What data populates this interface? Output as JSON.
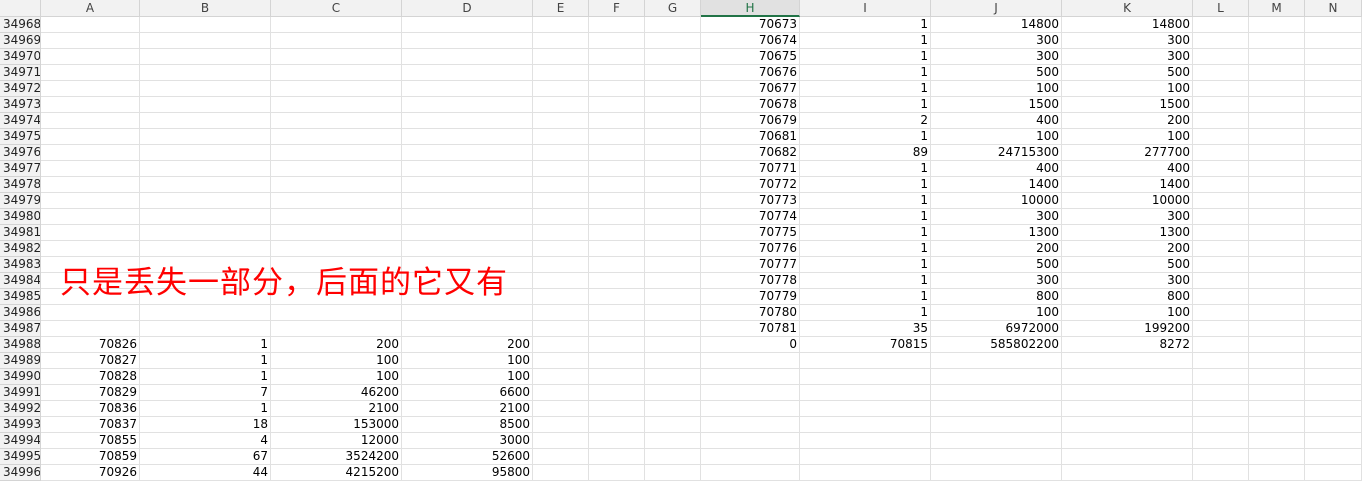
{
  "columns": [
    "A",
    "B",
    "C",
    "D",
    "E",
    "F",
    "G",
    "H",
    "I",
    "J",
    "K",
    "L",
    "M",
    "N"
  ],
  "selected_column": "H",
  "row_numbers": [
    34968,
    34969,
    34970,
    34971,
    34972,
    34973,
    34974,
    34975,
    34976,
    34977,
    34978,
    34979,
    34980,
    34981,
    34982,
    34983,
    34984,
    34985,
    34986,
    34987,
    34988,
    34989,
    34990,
    34991,
    34992,
    34993,
    34994,
    34995,
    34996
  ],
  "left_block": {
    "start_row_index": 20,
    "rows": [
      [
        "70826",
        "1",
        "200",
        "200"
      ],
      [
        "70827",
        "1",
        "100",
        "100"
      ],
      [
        "70828",
        "1",
        "100",
        "100"
      ],
      [
        "70829",
        "7",
        "46200",
        "6600"
      ],
      [
        "70836",
        "1",
        "2100",
        "2100"
      ],
      [
        "70837",
        "18",
        "153000",
        "8500"
      ],
      [
        "70855",
        "4",
        "12000",
        "3000"
      ],
      [
        "70859",
        "67",
        "3524200",
        "52600"
      ],
      [
        "70926",
        "44",
        "4215200",
        "95800"
      ]
    ]
  },
  "right_block": {
    "start_row_index": 0,
    "rows": [
      [
        "70673",
        "1",
        "14800",
        "14800"
      ],
      [
        "70674",
        "1",
        "300",
        "300"
      ],
      [
        "70675",
        "1",
        "300",
        "300"
      ],
      [
        "70676",
        "1",
        "500",
        "500"
      ],
      [
        "70677",
        "1",
        "100",
        "100"
      ],
      [
        "70678",
        "1",
        "1500",
        "1500"
      ],
      [
        "70679",
        "2",
        "400",
        "200"
      ],
      [
        "70681",
        "1",
        "100",
        "100"
      ],
      [
        "70682",
        "89",
        "24715300",
        "277700"
      ],
      [
        "70771",
        "1",
        "400",
        "400"
      ],
      [
        "70772",
        "1",
        "1400",
        "1400"
      ],
      [
        "70773",
        "1",
        "10000",
        "10000"
      ],
      [
        "70774",
        "1",
        "300",
        "300"
      ],
      [
        "70775",
        "1",
        "1300",
        "1300"
      ],
      [
        "70776",
        "1",
        "200",
        "200"
      ],
      [
        "70777",
        "1",
        "500",
        "500"
      ],
      [
        "70778",
        "1",
        "300",
        "300"
      ],
      [
        "70779",
        "1",
        "800",
        "800"
      ],
      [
        "70780",
        "1",
        "100",
        "100"
      ],
      [
        "70781",
        "35",
        "6972000",
        "199200"
      ],
      [
        "0",
        "70815",
        "585802200",
        "8272"
      ]
    ]
  },
  "annotation_text": "只是丢失一部分，后面的它又有",
  "colors": {
    "annotation": "#ff0000",
    "selected_header": "#217346",
    "header_bg": "#f2f2f2",
    "gridline": "#e1e1e1"
  }
}
